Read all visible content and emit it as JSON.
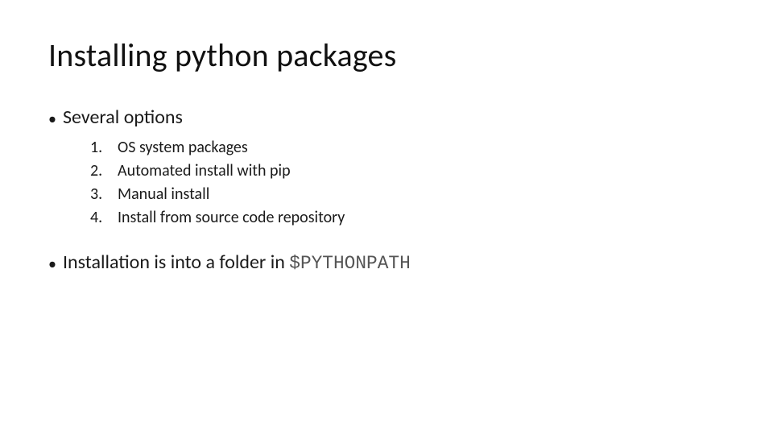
{
  "title": "Installing python packages",
  "bullets": {
    "options_label": "Several options",
    "install_prefix": "Installation is into a folder in ",
    "install_path": "$PYTHONPATH"
  },
  "options_list": [
    {
      "num": "1.",
      "text": "OS system packages"
    },
    {
      "num": "2.",
      "text": "Automated install with pip"
    },
    {
      "num": "3.",
      "text": "Manual install"
    },
    {
      "num": "4.",
      "text": "Install from source code repository"
    }
  ]
}
